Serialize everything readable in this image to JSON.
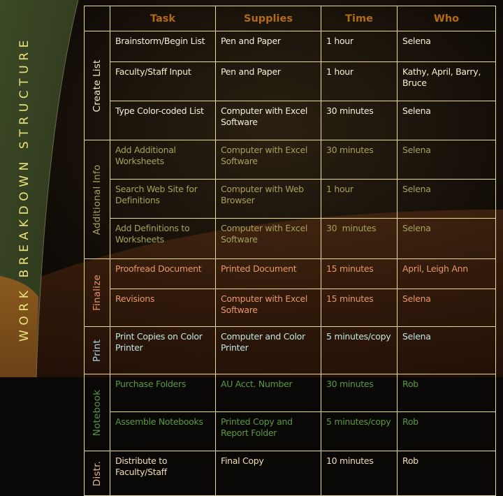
{
  "slide": {
    "side_title": "WORK BREAKDOWN STRUCTURE",
    "colors": {
      "border": "#e9dc9a",
      "header_text": "#b36a12",
      "create_list": "#f3efd6",
      "additional_info": "#a7a05a",
      "finalize": "#e8966a",
      "print": "#bfe6e0",
      "notebook": "#5a9a3e",
      "distr": "#f1deb4"
    }
  },
  "table": {
    "headers": {
      "phase": "",
      "task": "Task",
      "supplies": "Supplies",
      "time": "Time",
      "who": "Who"
    },
    "phases": [
      {
        "label": "Create List",
        "rows": [
          {
            "task": "Brainstorm/Begin List",
            "supplies": "Pen and Paper",
            "time": "1 hour",
            "who": "Selena"
          },
          {
            "task": "Faculty/Staff Input",
            "supplies": "Pen and Paper",
            "time": "1 hour",
            "who": "Kathy, April, Barry, Bruce"
          },
          {
            "task": "Type Color-coded List",
            "supplies": "Computer with Excel Software",
            "time": "30 minutes",
            "who": "Selena"
          }
        ]
      },
      {
        "label": "Additional Info",
        "rows": [
          {
            "task": "Add Additional Worksheets",
            "supplies": "Computer with Excel Software",
            "time": "30 minutes",
            "who": "Selena"
          },
          {
            "task": "Search Web Site for Definitions",
            "supplies": "Computer with Web Browser",
            "time": "1 hour",
            "who": "Selena"
          },
          {
            "task": "Add Definitions to Worksheets",
            "supplies": "Computer with Excel Software",
            "time": "30  minutes",
            "who": "Selena"
          }
        ]
      },
      {
        "label": "Finalize",
        "rows": [
          {
            "task": "Proofread Document",
            "supplies": "Printed Document",
            "time": "15 minutes",
            "who": "April, Leigh Ann"
          },
          {
            "task": "Revisions",
            "supplies": "Computer with Excel Software",
            "time": "15 minutes",
            "who": "Selena"
          }
        ]
      },
      {
        "label": "Print",
        "rows": [
          {
            "task": "Print Copies on Color Printer",
            "supplies": "Computer and Color Printer",
            "time": "5 minutes/copy",
            "who": "Selena"
          }
        ]
      },
      {
        "label": "Notebook",
        "rows": [
          {
            "task": "Purchase Folders",
            "supplies": "AU Acct. Number",
            "time": "30 minutes",
            "who": "Rob"
          },
          {
            "task": "Assemble Notebooks",
            "supplies": "Printed Copy and Report Folder",
            "time": "5 minutes/copy",
            "who": "Rob"
          }
        ]
      },
      {
        "label": "Distr.",
        "rows": [
          {
            "task": "Distribute to Faculty/Staff",
            "supplies": "Final Copy",
            "time": "10 minutes",
            "who": "Rob"
          }
        ]
      }
    ]
  }
}
